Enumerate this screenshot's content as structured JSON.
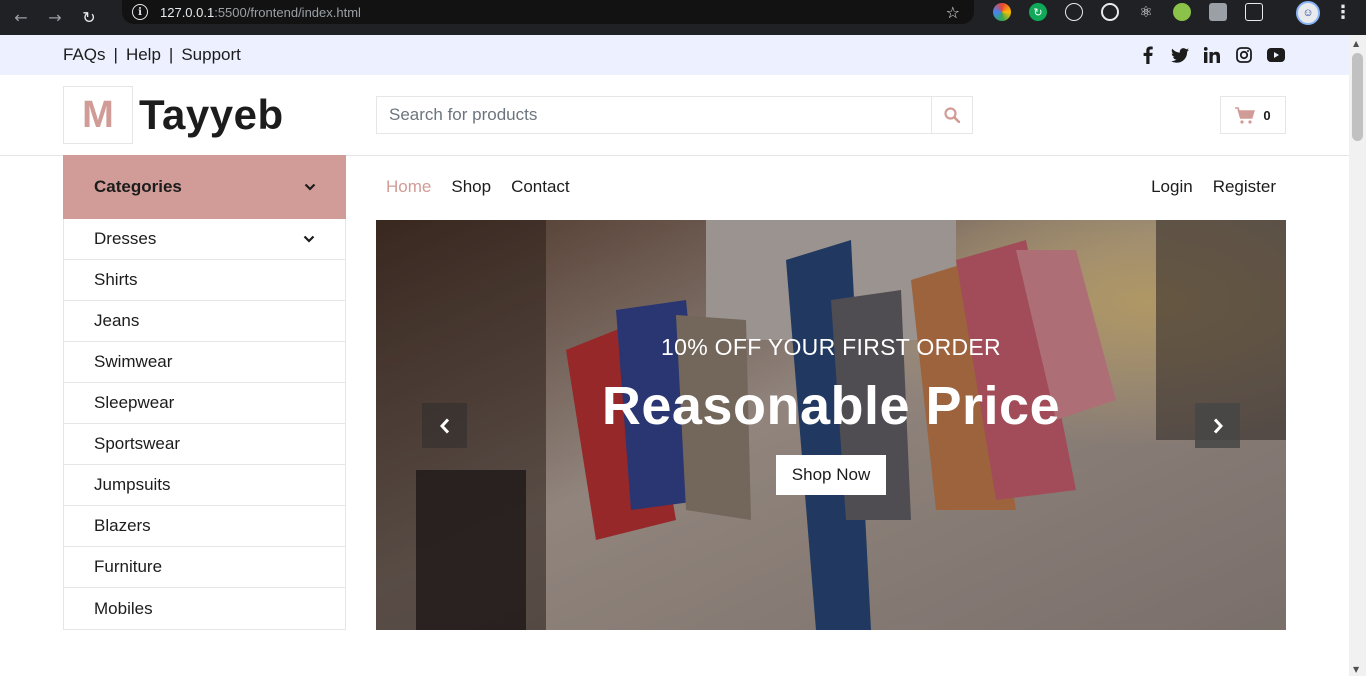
{
  "browser": {
    "url_host": "127.0.0.1",
    "url_path": ":5500/frontend/index.html",
    "info_glyph": "i"
  },
  "topbar": {
    "links": [
      "FAQs",
      "Help",
      "Support"
    ],
    "separator": "|",
    "social_icons": [
      "facebook-icon",
      "twitter-icon",
      "linkedin-icon",
      "instagram-icon",
      "youtube-icon"
    ]
  },
  "header": {
    "logo_letter": "M",
    "logo_name": "Tayyeb",
    "search_placeholder": "Search for products",
    "cart_count": "0"
  },
  "categories": {
    "title": "Categories",
    "items": [
      "Dresses",
      "Shirts",
      "Jeans",
      "Swimwear",
      "Sleepwear",
      "Sportswear",
      "Jumpsuits",
      "Blazers",
      "Furniture",
      "Mobiles"
    ]
  },
  "nav": {
    "left": [
      "Home",
      "Shop",
      "Contact"
    ],
    "right": [
      "Login",
      "Register"
    ],
    "active": "Home"
  },
  "hero": {
    "subtitle": "10% OFF YOUR FIRST ORDER",
    "title": "Reasonable Price",
    "button": "Shop Now"
  },
  "colors": {
    "accent": "#d19c97",
    "topbar_bg": "#edf1ff",
    "text": "#1c1c1c"
  }
}
